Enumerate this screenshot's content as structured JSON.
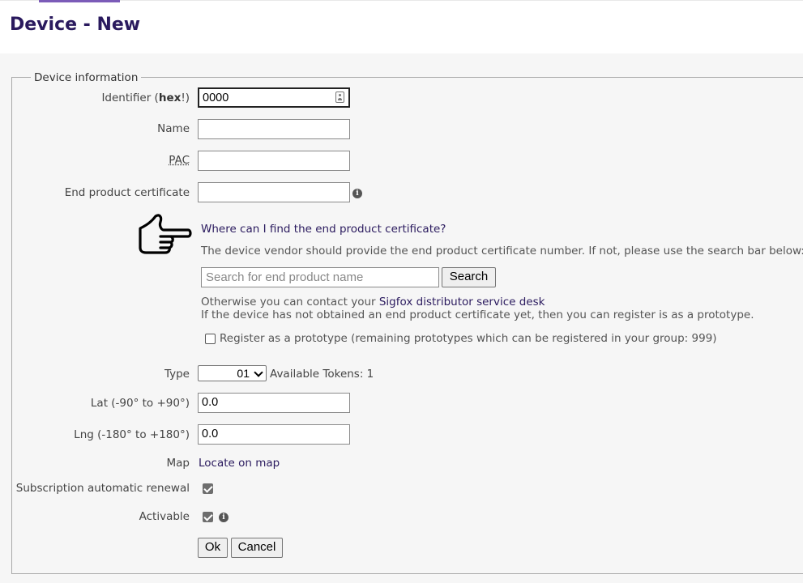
{
  "page": {
    "title": "Device - New"
  },
  "fieldset": {
    "legend": "Device information"
  },
  "identifier": {
    "label_prefix": "Identifier (",
    "label_bold": "hex",
    "label_suffix": "!)",
    "value": "0000"
  },
  "name": {
    "label": "Name",
    "value": ""
  },
  "pac": {
    "label": "PAC",
    "value": ""
  },
  "epc": {
    "label": "End product certificate",
    "value": ""
  },
  "help": {
    "question": "Where can I find the end product certificate?",
    "text": "The device vendor should provide the end product certificate number. If not, please use the search bar below:",
    "search_placeholder": "Search for end product name",
    "search_button": "Search",
    "contact_prefix": "Otherwise you can contact your ",
    "contact_link": "Sigfox distributor service desk",
    "prototype_text": "If the device has not obtained an end product certificate yet, then you can register is as a prototype.",
    "prototype_checkbox_label": "Register as a prototype (remaining prototypes which can be registered in your group: 999)",
    "prototype_checked": false
  },
  "type": {
    "label": "Type",
    "selected": "01",
    "tokens": "Available Tokens: 1"
  },
  "lat": {
    "label": "Lat (-90° to +90°)",
    "value": "0.0"
  },
  "lng": {
    "label": "Lng (-180° to +180°)",
    "value": "0.0"
  },
  "map": {
    "label": "Map",
    "link": "Locate on map"
  },
  "renewal": {
    "label": "Subscription automatic renewal",
    "checked": true
  },
  "activable": {
    "label": "Activable",
    "checked": true
  },
  "actions": {
    "ok": "Ok",
    "cancel": "Cancel"
  },
  "icons": {
    "info": "info-icon",
    "contact": "contact-card-icon",
    "pointer": "pointing-hand-icon"
  }
}
